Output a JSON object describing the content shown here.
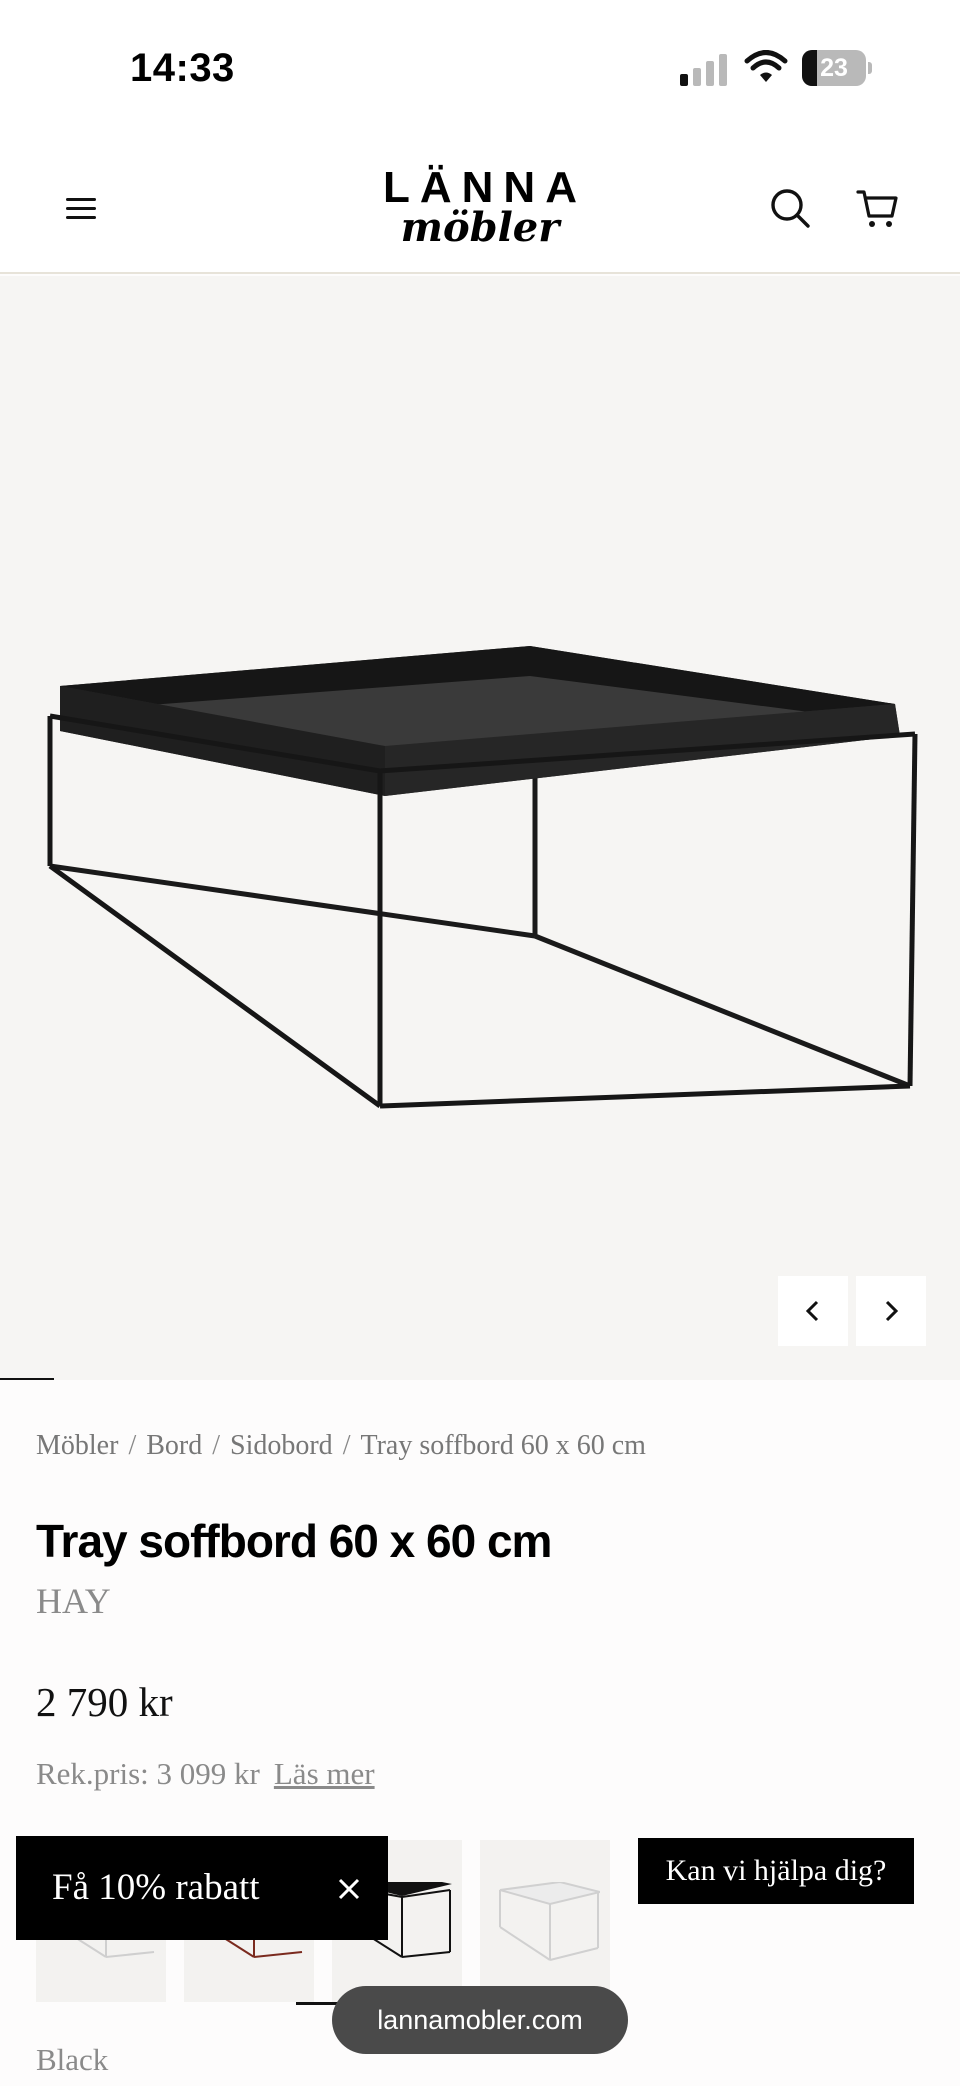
{
  "status_bar": {
    "time": "14:33",
    "battery_level": "23",
    "icons": [
      "signal-icon",
      "wifi-icon",
      "battery-icon"
    ]
  },
  "header": {
    "logo_top": "LÄNNA",
    "logo_bottom": "möbler",
    "icons": [
      "menu-icon",
      "search-icon",
      "cart-icon"
    ]
  },
  "gallery": {
    "image_alt": "Tray soffbord 60 x 60 cm",
    "icons": [
      "chevron-left-icon",
      "chevron-right-icon"
    ],
    "background": "#f6f5f3"
  },
  "breadcrumb": [
    "Möbler",
    "Bord",
    "Sidobord",
    "Tray soffbord 60 x 60 cm"
  ],
  "breadcrumb_sep": "/",
  "product": {
    "title": "Tray soffbord 60 x 60 cm",
    "brand": "HAY",
    "price": "2 790 kr",
    "rek_price": "Rek.pris: 3 099 kr",
    "read_more": "Läs mer",
    "color_label": "Black"
  },
  "swatches": [
    {
      "name": "white",
      "color": "#cfcfcf"
    },
    {
      "name": "red",
      "color": "#7a2a1e"
    },
    {
      "name": "black",
      "color": "#111111",
      "selected": true
    },
    {
      "name": "light",
      "color": "#d6d6d6"
    }
  ],
  "promo": {
    "label": "Få 10% rabatt",
    "close_icon": "close-icon"
  },
  "help_button": "Kan vi hjälpa dig?",
  "url_pill": "lannamobler.com"
}
